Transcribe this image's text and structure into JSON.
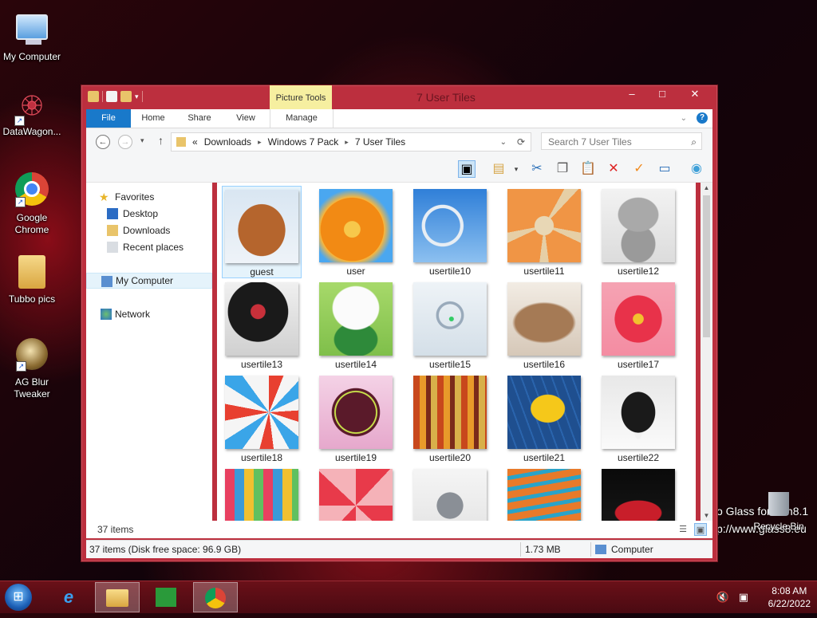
{
  "desktop": {
    "icons": [
      {
        "label": "My Computer",
        "icon": "computer-icon"
      },
      {
        "label": "DataWagon...",
        "icon": "datawagon-icon"
      },
      {
        "label": "Google Chrome",
        "icon": "chrome-icon"
      },
      {
        "label": "Tubbo pics",
        "icon": "folder-icon"
      },
      {
        "label": "AG Blur Tweaker",
        "icon": "agblur-icon"
      }
    ],
    "watermark_line1": "o Glass for Win8.1",
    "watermark_line2": "p://www.glass8.eu",
    "recycle_bin": "Recycle Bin"
  },
  "window": {
    "title": "7 User Tiles",
    "context_tab_group": "Picture Tools",
    "ribbon_tabs": [
      "File",
      "Home",
      "Share",
      "View",
      "Manage"
    ],
    "address": {
      "prefix": "«",
      "crumbs": [
        "Downloads",
        "Windows 7 Pack",
        "7 User Tiles"
      ]
    },
    "search": {
      "placeholder": "Search 7 User Tiles"
    },
    "nav_pane": {
      "favorites": "Favorites",
      "desktop": "Desktop",
      "downloads": "Downloads",
      "recent": "Recent places",
      "computer": "My Computer",
      "network": "Network"
    },
    "files": [
      {
        "name": "guest",
        "selected": true
      },
      {
        "name": "user"
      },
      {
        "name": "usertile10"
      },
      {
        "name": "usertile11"
      },
      {
        "name": "usertile12"
      },
      {
        "name": "usertile13"
      },
      {
        "name": "usertile14"
      },
      {
        "name": "usertile15"
      },
      {
        "name": "usertile16"
      },
      {
        "name": "usertile17"
      },
      {
        "name": "usertile18"
      },
      {
        "name": "usertile19"
      },
      {
        "name": "usertile20"
      },
      {
        "name": "usertile21"
      },
      {
        "name": "usertile22"
      },
      {
        "name": ""
      },
      {
        "name": ""
      },
      {
        "name": ""
      },
      {
        "name": ""
      },
      {
        "name": ""
      }
    ],
    "item_count": "37 items",
    "status": {
      "summary": "37 items (Disk free space: 96.9 GB)",
      "size": "1.73 MB",
      "location": "Computer"
    }
  },
  "taskbar": {
    "time": "8:08 AM",
    "date": "6/22/2022",
    "buttons": [
      "start-orb",
      "internet-explorer",
      "file-explorer",
      "store",
      "chrome"
    ]
  },
  "colors": {
    "window_frame": "#bc2f3e",
    "file_tab": "#1979ca",
    "selection": "#e5f3fb",
    "taskbar": "#5a0c14"
  }
}
